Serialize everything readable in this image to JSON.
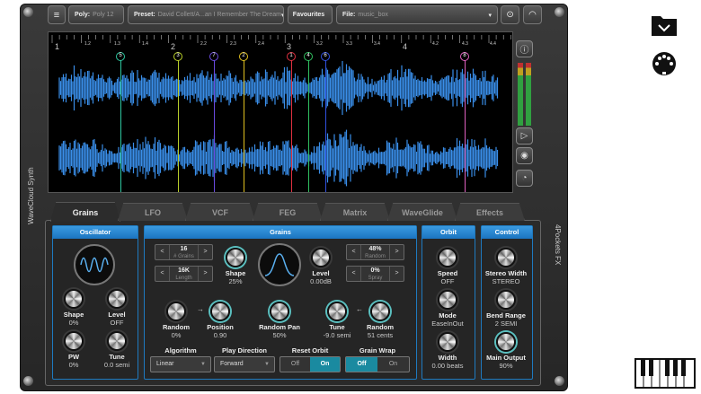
{
  "toolbar": {
    "menu_icon": "hamburger-icon",
    "poly_label": "Poly:",
    "poly_value": "Poly 12",
    "preset_label": "Preset:",
    "preset_value": "David Collett/A...an I Remember The Dream",
    "favourites": "Favourites",
    "file_label": "File:",
    "file_value": "music_box",
    "upload_icon": "upload-icon",
    "meter_icon": "gauge-icon"
  },
  "ruler": {
    "labels": [
      "1",
      "1.2",
      "1.3",
      "1.4",
      "2",
      "2.2",
      "2.3",
      "2.4",
      "3",
      "3.2",
      "3.3",
      "3.4",
      "4",
      "4.2",
      "4.3",
      "4.4"
    ]
  },
  "markers": [
    {
      "n": "5",
      "color": "#2ec7a0"
    },
    {
      "n": "3",
      "color": "#b9cf2a"
    },
    {
      "n": "7",
      "color": "#6a4ae0"
    },
    {
      "n": "2",
      "color": "#e0c020"
    },
    {
      "n": "1",
      "color": "#e03040"
    },
    {
      "n": "4",
      "color": "#30c060"
    },
    {
      "n": "6",
      "color": "#3050e0"
    },
    {
      "n": "8",
      "color": "#e060c0"
    }
  ],
  "waveform_color": "#3a8ee8",
  "side_labels": {
    "left": "WaveCloud Synth",
    "right": "4Pockets FX"
  },
  "tabs": [
    "Grains",
    "LFO",
    "VCF",
    "FEG",
    "Matrix",
    "WaveGlide",
    "Effects"
  ],
  "active_tab": "Grains",
  "oscillator": {
    "title": "Oscillator",
    "knobs": [
      {
        "label": "Shape",
        "value": "0%"
      },
      {
        "label": "Level",
        "value": "OFF"
      },
      {
        "label": "PW",
        "value": "0%"
      },
      {
        "label": "Tune",
        "value": "0.0 semi"
      }
    ]
  },
  "grains": {
    "title": "Grains",
    "steppers": [
      {
        "value": "16",
        "label": "# Grains"
      },
      {
        "value": "16K",
        "label": "Length"
      },
      {
        "value": "48%",
        "label": "Random"
      },
      {
        "value": "0%",
        "label": "Spray"
      }
    ],
    "shape": {
      "label": "Shape",
      "value": "25%"
    },
    "level": {
      "label": "Level",
      "value": "0.00dB"
    },
    "row": [
      {
        "label": "Random",
        "value": "0%"
      },
      {
        "label": "Position",
        "value": "0.90"
      },
      {
        "label": "Random Pan",
        "value": "50%"
      },
      {
        "label": "Tune",
        "value": "-9.0 semi"
      },
      {
        "label": "Random",
        "value": "51 cents"
      }
    ],
    "algorithm": {
      "label": "Algorithm",
      "value": "Linear"
    },
    "play_direction": {
      "label": "Play Direction",
      "value": "Forward"
    },
    "reset_orbit": {
      "label": "Reset Orbit",
      "off": "Off",
      "on": "On",
      "selected": "On"
    },
    "grain_wrap": {
      "label": "Grain Wrap",
      "off": "Off",
      "on": "On",
      "selected": "Off"
    }
  },
  "orbit": {
    "title": "Orbit",
    "knobs": [
      {
        "label": "Speed",
        "value": "OFF"
      },
      {
        "label": "Mode",
        "value": "EaseInOut"
      },
      {
        "label": "Width",
        "value": "0.00 beats"
      }
    ]
  },
  "control": {
    "title": "Control",
    "knobs": [
      {
        "label": "Stereo Width",
        "value": "STEREO"
      },
      {
        "label": "Bend Range",
        "value": "2 SEMI"
      },
      {
        "label": "Main Output",
        "value": "90%"
      }
    ]
  }
}
